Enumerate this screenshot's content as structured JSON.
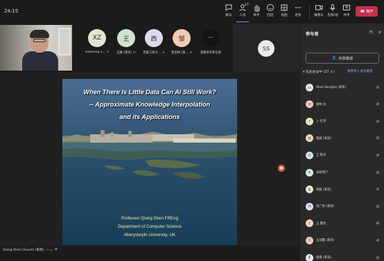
{
  "header": {
    "timer": "24:15",
    "people_count": "27",
    "buttons": [
      {
        "id": "chat",
        "label": "聊天"
      },
      {
        "id": "people",
        "label": "人员"
      },
      {
        "id": "raise",
        "label": "举手"
      },
      {
        "id": "react",
        "label": "回应"
      },
      {
        "id": "view",
        "label": "视图"
      },
      {
        "id": "more",
        "label": "更多"
      },
      {
        "id": "camera",
        "label": "摄像头"
      },
      {
        "id": "mic",
        "label": "音频/视"
      },
      {
        "id": "share",
        "label": "共享"
      }
    ],
    "leave_label": "离开"
  },
  "strip": {
    "self_tag": "",
    "participants": [
      {
        "initials": "XZ",
        "name": "Xiaohong Z...",
        "color": "#dfe7d1"
      },
      {
        "initials": "王",
        "name": "王維 (来宾)",
        "color": "#cfe3cf"
      },
      {
        "initials": "西",
        "name": "西安工程大...",
        "color": "#dcdbe9"
      },
      {
        "initials": "邹",
        "name": "邹金林 (来...",
        "color": "#f3ccb3"
      },
      {
        "initials": "···",
        "name": "查看所有参与者",
        "color": "#141414"
      }
    ],
    "ss_initials": "SS"
  },
  "slide": {
    "title_line1": "When There Is Little Data Can AI Still Work?",
    "title_line2": "-- Approximate Knowledge Interpolation",
    "title_line3": "and its Applications",
    "credit_line1": "Professor Qiang Shen FREng",
    "credit_line2": "Department of Computer Science",
    "credit_line3": "Aberystwyth University, UK"
  },
  "footer": {
    "presenter": "Qiang Shen (Guest) (来宾)",
    "zoom_minus": "−",
    "zoom_plus": "+"
  },
  "panel": {
    "title": "参与者",
    "share_invite": "共享邀请",
    "section_label": "在此会议中 (27 人)",
    "mute_all": "将所有人设为静音",
    "people": [
      {
        "initials": "SS",
        "name": "Shao Songtao (来宾)",
        "color": "#e6e6ee"
      },
      {
        "initials": "刘",
        "name": "郑林 刘",
        "color": "#f2c6c6"
      },
      {
        "initials": "卜",
        "name": "卜 红英",
        "color": "#dfe8c9"
      },
      {
        "initials": "钱",
        "name": "钱斌 (来宾)",
        "color": "#f1d2c0"
      },
      {
        "initials": "江",
        "name": "江 陈杰",
        "color": "#cfe1ef"
      },
      {
        "initials": "未",
        "name": "未知用户",
        "color": "#d6eaea"
      },
      {
        "initials": "梁",
        "name": "梁毅 (来宾)",
        "color": "#dde9cf"
      },
      {
        "initials": "刘",
        "name": "刘广辉 (来宾)",
        "color": "#e3dbef"
      },
      {
        "initials": "王",
        "name": "王 雷怡",
        "color": "#f1d6c4"
      },
      {
        "initials": "王",
        "name": "王战鑫 (来宾)",
        "color": "#f2c6c6"
      },
      {
        "initials": "袁",
        "name": "袁慧 (来宾)",
        "color": "#e6e6ee"
      }
    ]
  },
  "colors": {
    "accent": "#8b8cf5",
    "leave": "#c4314b",
    "slide_text": "#f3e9a6"
  }
}
